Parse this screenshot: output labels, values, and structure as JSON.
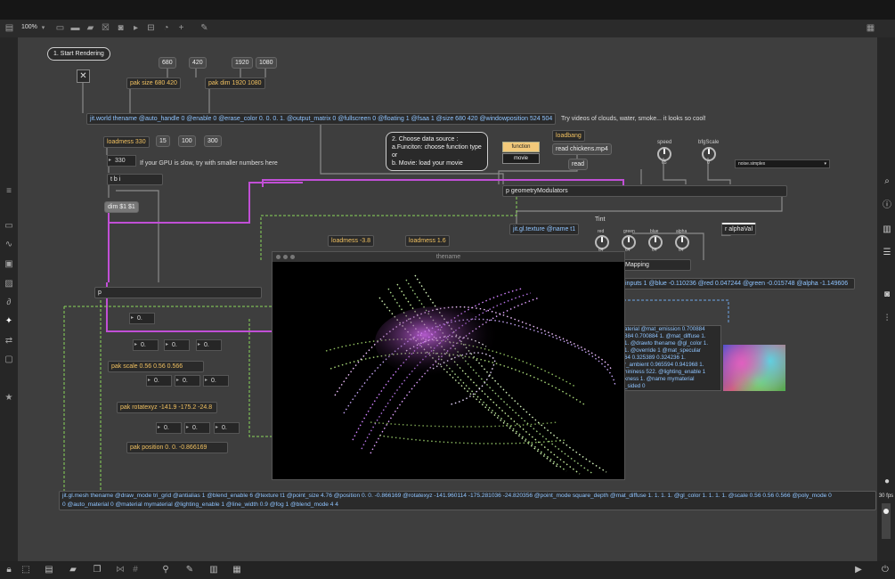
{
  "toolbar": {
    "zoom": "100%",
    "icons": [
      "presentation-icon",
      "patcher-icon",
      "comment-icon",
      "toggle-icon",
      "button-icon",
      "number-icon",
      "slider-icon",
      "dial-icon",
      "plus-icon",
      "paint-icon"
    ]
  },
  "patch": {
    "start_bubble": "1. Start Rendering",
    "num_680": "680",
    "num_420": "420",
    "num_1920": "1920",
    "num_1080": "1080",
    "pak_size": "pak size 680 420",
    "pak_dim": "pak dim 1920 1080",
    "jit_world": "jit.world thename @auto_handle 0 @enable 0 @erase_color 0. 0. 0. 1. @output_matrix 0 @fullscreen 0 @floating 1 @fsaa 1 @size 680 420 @windowposition 524 504",
    "comment_videos": "Try videos of clouds, water, smoke... it looks so cool!",
    "loadmess_330": "loadmess 330",
    "msg_15": "15",
    "msg_100": "100",
    "msg_300": "300",
    "num_330": "330",
    "gpu_comment": "If your GPU is slow, try with smaller numbers here",
    "tbi": "t b i",
    "dim_msg": "dim $1 $1",
    "data_source_bubble": "2. Choose data source :\na.Funciton: choose function type\nor\nb. Movie: load your movie",
    "function_btn": "function",
    "movie_btn": "movie",
    "loadbang": "loadbang",
    "read_chickens": "read chickens.mp4",
    "read_msg": "read",
    "speed_label": "speed",
    "speed_value": "65",
    "bfgscale_label": "bfgScale",
    "bfgscale_value": "0",
    "noise_menu": "noise.simplex",
    "geometry_modulators": "p geometryModulators",
    "jit_gl_texture": "jit.gl.texture @name t1",
    "tint_label": "Tint",
    "red_label": "red",
    "green_label": "green",
    "blue_label": "blue",
    "alpha_label": "alpha",
    "dial_value": "64",
    "r_alphaval": "r alphaVal",
    "mapping": "Mapping",
    "loadmess_neg38": "loadmess -3.8",
    "loadmess_16": "loadmess 1.6",
    "inputs_line": "inputs 1 @blue -0.110236 @red 0.047244 @green -0.015748 @alpha -1.149606",
    "material_text": "aterial @mat_emission 0.700884\n884 0.700884 1. @mat_diffuse 1.\n1. @drawto thename @gl_color 1.\n1. @override 1 @mat_specular\n64 0.325389 0.324236 1.\nr_ambient 0.965594 0.941968 1.\nhininess 522. @lighting_enable 1\nkness 1. @name mymaterial\n_sided 0",
    "p_label": "p",
    "num_zero": "0.",
    "pak_scale": "pak scale 0.56 0.56 0.566",
    "pak_rotatexyz": "pak rotatexyz -141.9 -175.2 -24.8",
    "pak_position": "pak position 0. 0. -0.866169",
    "mesh_line1": "jit.gl.mesh thename @draw_mode tri_grid @antialias 1 @blend_enable 6 @texture t1 @point_size 4.76 @position 0. 0. -0.866169 @rotatexyz -141.960114 -175.281036 -24.820356 @point_mode square_depth @mat_diffuse 1. 1. 1. 1. @gl_color 1. 1. 1. 1. @scale 0.56 0.56 0.566 @poly_mode 0",
    "mesh_line2": "0 @auto_material 0 @material mymaterial @lighting_enable 1 @line_width 0.9 @fog 1 @blend_mode 4 4",
    "render_title": "thename"
  },
  "right_sidebar": {
    "fps": "30 fps",
    "icons": [
      "search-icon",
      "info-icon",
      "book-icon",
      "list-icon",
      "camera-icon",
      "sliders-icon"
    ]
  },
  "left_sidebar": {
    "icons": [
      "menu-icon",
      "presentation-icon",
      "audio-icon",
      "media-icon",
      "image-icon",
      "link-icon",
      "puzzle-icon",
      "arrows-icon",
      "package-icon",
      "star-icon"
    ]
  },
  "bottom_bar": {
    "icons": [
      "lock-icon",
      "edit-icon",
      "grid-icon",
      "comment-icon",
      "windows-icon",
      "snap-icon",
      "grid2-icon",
      "debug-icon",
      "wrench-icon",
      "piano-icon",
      "midi-icon",
      "play-icon",
      "power-icon"
    ]
  },
  "colors": {
    "canvas": "#3e3e3e",
    "patchcord_purple": "#c14fd6",
    "patchcord_green": "#8ad65a",
    "patchcord_blue": "#6fa5e8"
  }
}
